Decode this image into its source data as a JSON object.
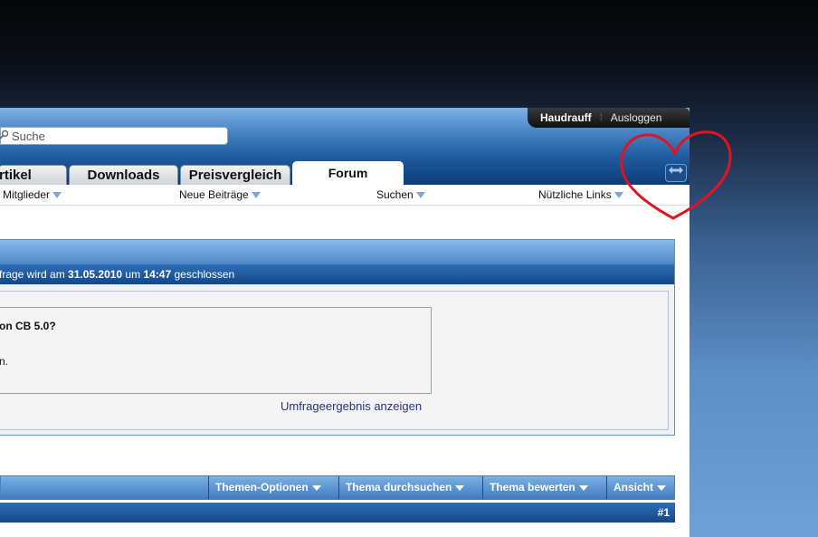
{
  "header": {
    "username": "Haudrauff",
    "separator": "⁞",
    "logout_label": "Ausloggen",
    "search_placeholder": "Suche"
  },
  "tabs": [
    {
      "label": "rtikel",
      "active": false
    },
    {
      "label": "Downloads",
      "active": false
    },
    {
      "label": "Preisvergleich",
      "active": false
    },
    {
      "label": "Forum",
      "active": true
    }
  ],
  "subnav": [
    {
      "label": "Mitglieder"
    },
    {
      "label": "Neue Beiträge"
    },
    {
      "label": "Suchen"
    },
    {
      "label": "Nützliche Links"
    }
  ],
  "poll": {
    "closing_prefix": "frage wird am ",
    "closing_date": "31.05.2010",
    "closing_mid": " um ",
    "closing_time": "14:47",
    "closing_suffix": " geschlossen",
    "question_fragment": "on CB 5.0?",
    "note_fragment": "n.",
    "result_link": "Umfrageergebnis anzeigen"
  },
  "thread_toolbar": [
    {
      "label": "Themen-Optionen"
    },
    {
      "label": "Thema durchsuchen"
    },
    {
      "label": "Thema bewerten"
    },
    {
      "label": "Ansicht"
    }
  ],
  "post": {
    "number": "#1"
  },
  "colors": {
    "header_blue": "#1f5a9e",
    "bar_blue": "#13478a",
    "link_color": "#27327f",
    "heart_annotation": "#e0141e"
  },
  "icons": {
    "search": "magnifier-icon",
    "resize": "resize-arrows-icon",
    "menu": "triangle-down-icon"
  }
}
